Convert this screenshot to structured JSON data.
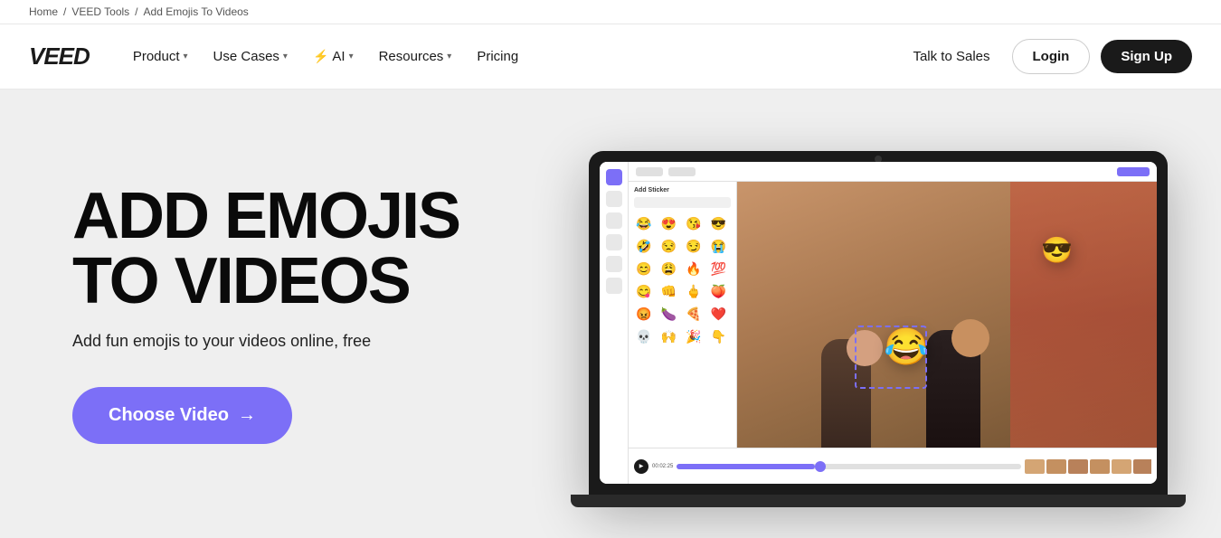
{
  "breadcrumb": {
    "items": [
      {
        "label": "Home",
        "href": "#"
      },
      {
        "label": "VEED Tools",
        "href": "#"
      },
      {
        "label": "Add Emojis To Videos",
        "href": "#"
      }
    ],
    "separator": "/"
  },
  "navbar": {
    "logo": "VEED",
    "nav_items": [
      {
        "label": "Product",
        "has_dropdown": true
      },
      {
        "label": "Use Cases",
        "has_dropdown": true
      },
      {
        "label": "AI",
        "has_dropdown": true,
        "has_bolt": true
      },
      {
        "label": "Resources",
        "has_dropdown": true
      },
      {
        "label": "Pricing",
        "has_dropdown": false
      }
    ],
    "talk_to_sales": "Talk to Sales",
    "login": "Login",
    "signup": "Sign Up"
  },
  "hero": {
    "title": "ADD EMOJIS TO VIDEOS",
    "subtitle": "Add fun emojis to your videos online, free",
    "cta_label": "Choose Video",
    "cta_arrow": "→"
  },
  "editor": {
    "panel_title": "Add Sticker",
    "stickers": [
      "😂",
      "😍",
      "😘",
      "😎",
      "🤣",
      "😒",
      "😏",
      "😭",
      "😊",
      "😩",
      "🔥",
      "💯",
      "😋",
      "👊",
      "🖕",
      "🍑",
      "😡",
      "🍆",
      "🍕",
      "❤️",
      "💀",
      "🙌",
      "🎉",
      "👇"
    ]
  },
  "colors": {
    "accent": "#7c6ff7",
    "dark": "#1a1a1a",
    "bg": "#efefef"
  }
}
